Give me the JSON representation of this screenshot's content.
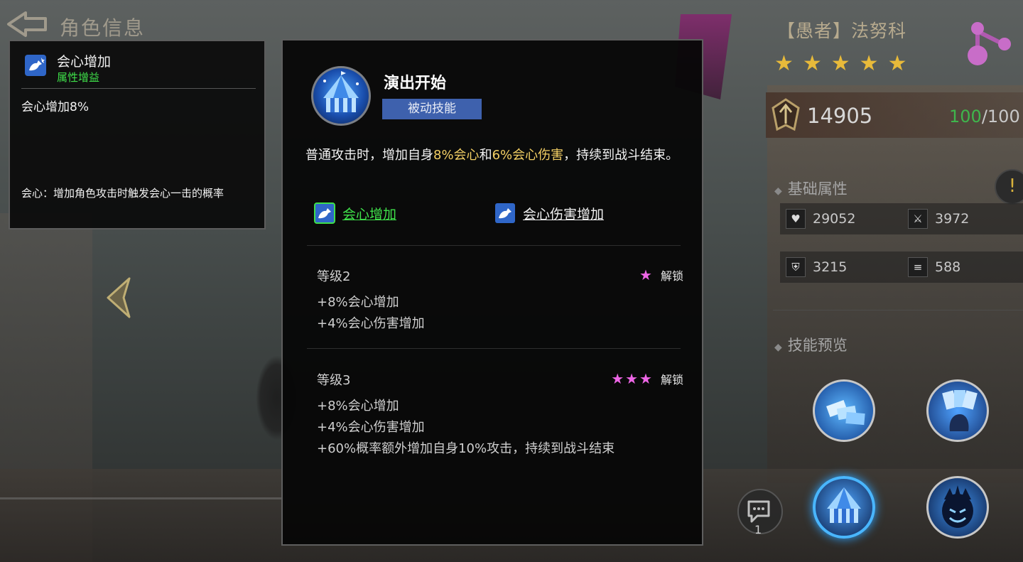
{
  "header": {
    "title": "角色信息"
  },
  "tooltip": {
    "title": "会心增加",
    "subtitle": "属性增益",
    "value": "会心增加8%",
    "description": "会心：增加角色攻击时触发会心一击的概率",
    "icon": "crit-up-icon"
  },
  "skill": {
    "name": "演出开始",
    "type": "被动技能",
    "icon": "circus-tent-icon",
    "desc_parts": [
      "普通攻击时，增加自身",
      "8%会心",
      "和",
      "6%会心伤害",
      "，持续到战斗结束。"
    ],
    "links": [
      {
        "label": "会心增加",
        "icon": "crit-up-icon",
        "selected": true
      },
      {
        "label": "会心伤害增加",
        "icon": "crit-damage-up-icon",
        "selected": false
      }
    ],
    "levels": [
      {
        "title": "等级2",
        "stars": "★",
        "unlock": "解锁",
        "lines": [
          "+8%会心增加",
          "+4%会心伤害增加"
        ]
      },
      {
        "title": "等级3",
        "stars": "★★★",
        "unlock": "解锁",
        "lines": [
          "+8%会心增加",
          "+4%会心伤害增加",
          "+60%概率额外增加自身10%攻击，持续到战斗结束"
        ]
      }
    ]
  },
  "hero": {
    "name": "【愚者】法努科",
    "stars": "★★★★★",
    "power": "14905",
    "energy_current": "100",
    "energy_max": "/100"
  },
  "sections": {
    "base_attributes": "基础属性",
    "skill_preview": "技能预览"
  },
  "stats": {
    "hp": "29052",
    "attack": "3972",
    "defense": "3215",
    "speed": "588"
  },
  "skill_thumbs": [
    "card-throw-icon",
    "card-hand-icon",
    "circus-tent-icon",
    "shadow-face-icon"
  ],
  "chat": {
    "count": "1"
  },
  "colors": {
    "accent_green": "#3fe04a",
    "highlight_gold": "#f3cf64",
    "tag_blue": "#3e61ad",
    "star_gold": "#e8ba3a",
    "star_pink": "#ee66e6"
  }
}
